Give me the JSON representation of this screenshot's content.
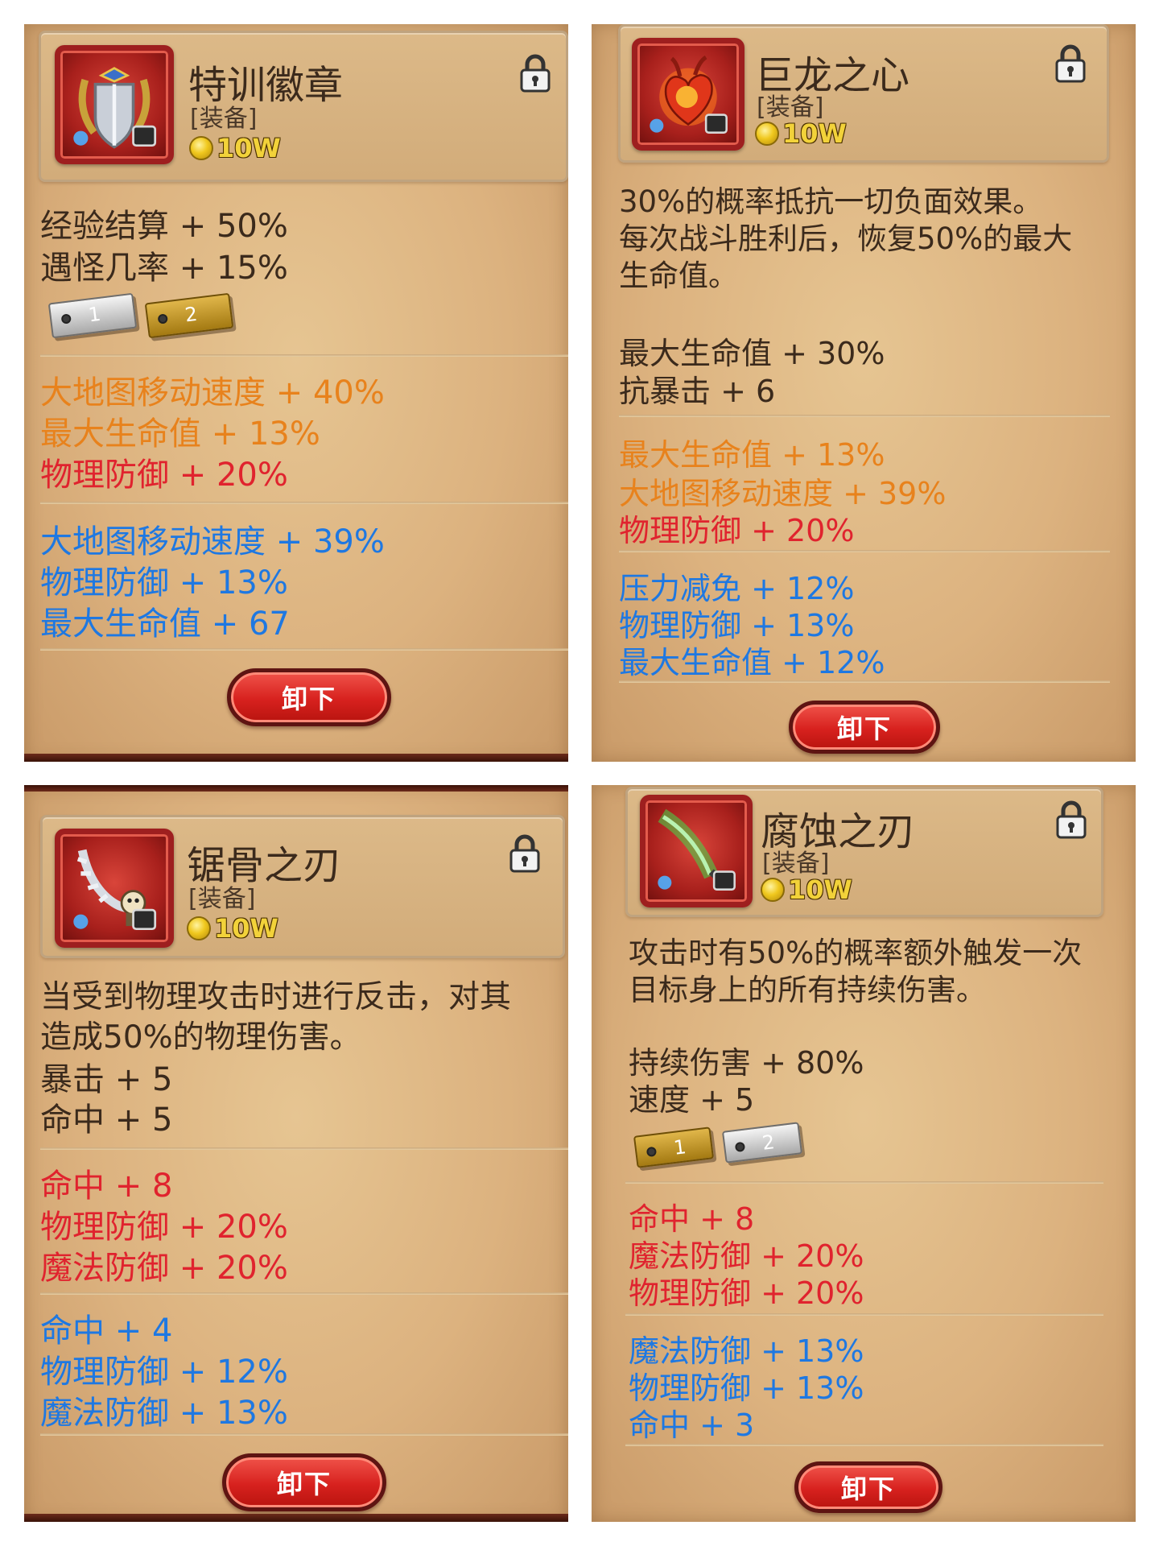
{
  "colors": {
    "dark_text": "#3b2a1c",
    "orange_stat": "#e8821c",
    "red_stat": "#e0232e",
    "blue_stat": "#1e78e2",
    "button_red": "#d7211e",
    "parchment": "#dcb27f"
  },
  "cards": [
    {
      "name": "特训徽章",
      "type": "[装备]",
      "price": "10W",
      "icon": "shield-badge-icon",
      "base_stats": [
        "经验结算 + 50%",
        "遇怪几率 + 15%"
      ],
      "tags": [
        "1",
        "2"
      ],
      "orange_stats": [
        "大地图移动速度 + 40%",
        "最大生命值 + 13%"
      ],
      "red_stats": [
        "物理防御 + 20%"
      ],
      "blue_stats": [
        "大地图移动速度 + 39%",
        "物理防御 + 13%",
        "最大生命值 + 67"
      ],
      "button": "卸下"
    },
    {
      "name": "巨龙之心",
      "type": "[装备]",
      "price": "10W",
      "icon": "dragon-heart-icon",
      "description": [
        "30%的概率抵抗一切负面效果。",
        "每次战斗胜利后，恢复50%的最大",
        "生命值。"
      ],
      "base_stats": [
        "最大生命值 + 30%",
        "抗暴击 + 6"
      ],
      "orange_stats": [
        "最大生命值 + 13%",
        "大地图移动速度 + 39%"
      ],
      "red_stats": [
        "物理防御 + 20%"
      ],
      "blue_stats": [
        "压力减免 + 12%",
        "物理防御 + 13%",
        "最大生命值 + 12%"
      ],
      "button": "卸下"
    },
    {
      "name": "锯骨之刃",
      "type": "[装备]",
      "price": "10W",
      "icon": "bone-saw-blade-icon",
      "description": [
        "当受到物理攻击时进行反击，对其",
        "造成50%的物理伤害。"
      ],
      "base_stats": [
        "暴击 + 5",
        "命中 + 5"
      ],
      "red_stats": [
        "命中 + 8",
        "物理防御 + 20%",
        "魔法防御 + 20%"
      ],
      "blue_stats": [
        "命中 + 4",
        "物理防御 + 12%",
        "魔法防御 + 13%"
      ],
      "button": "卸下"
    },
    {
      "name": "腐蚀之刃",
      "type": "[装备]",
      "price": "10W",
      "icon": "corrosion-blade-icon",
      "description": [
        "攻击时有50%的概率额外触发一次",
        "目标身上的所有持续伤害。"
      ],
      "base_stats": [
        "持续伤害 + 80%",
        "速度 + 5"
      ],
      "tags": [
        "1",
        "2"
      ],
      "red_stats": [
        "命中 + 8",
        "魔法防御 + 20%",
        "物理防御 + 20%"
      ],
      "blue_stats": [
        "魔法防御 + 13%",
        "物理防御 + 13%",
        "命中 + 3"
      ],
      "button": "卸下"
    }
  ]
}
